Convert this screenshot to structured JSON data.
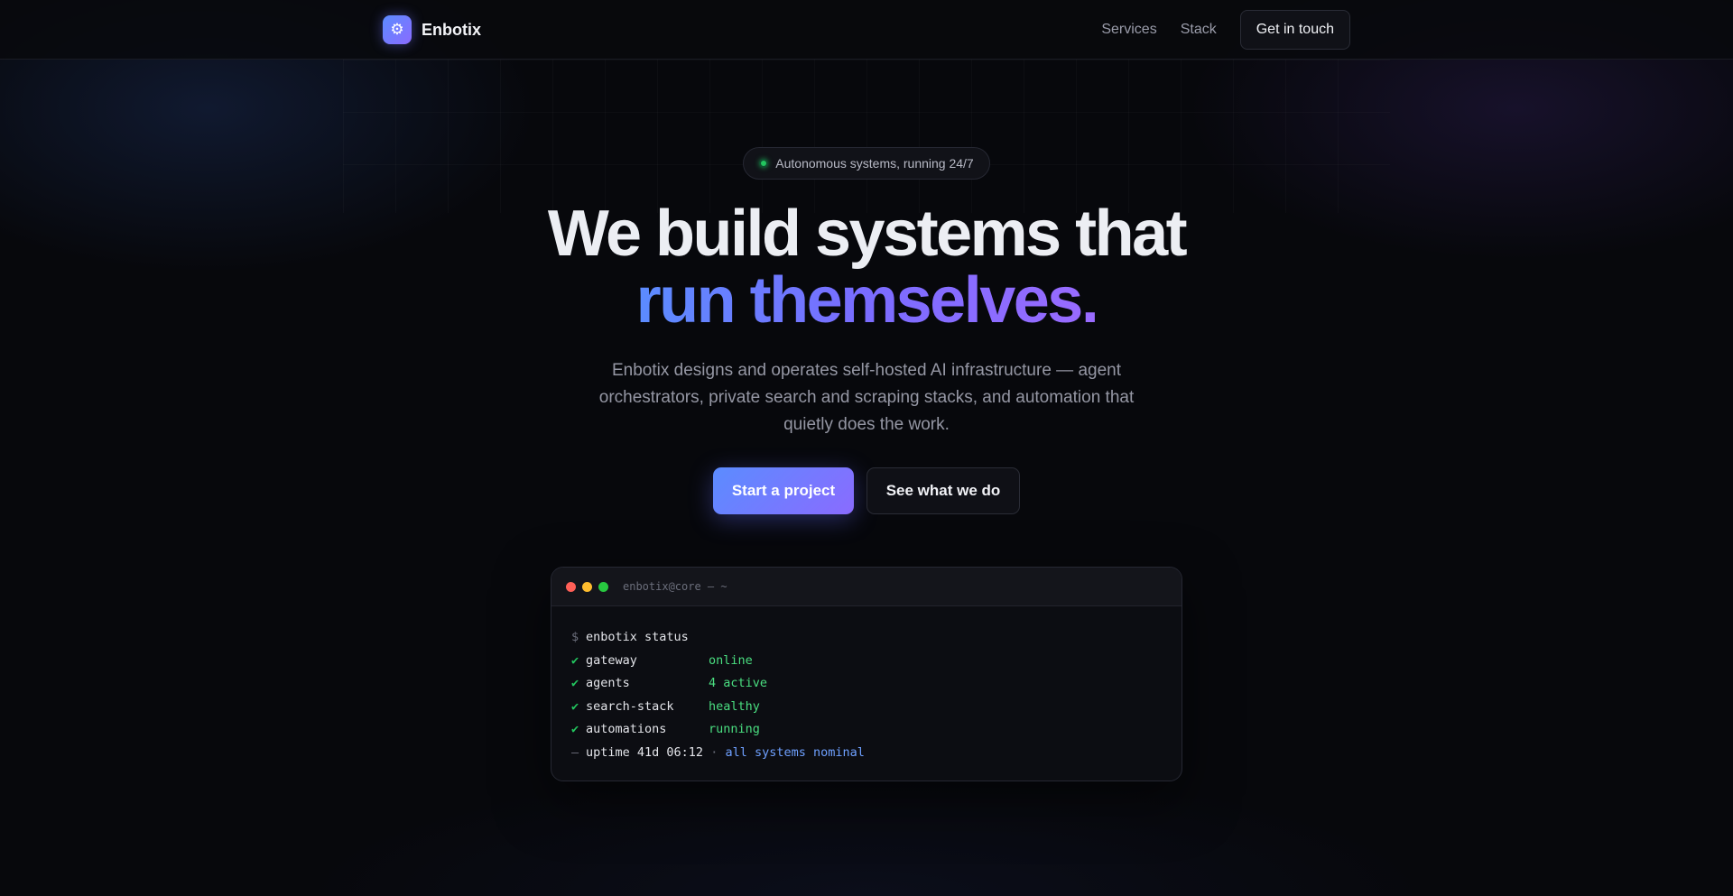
{
  "nav": {
    "brand_icon": "gear-icon",
    "brand_name": "Enbotix",
    "links": [
      "Services",
      "Stack"
    ],
    "cta": "Get in touch"
  },
  "hero": {
    "badge": "Autonomous systems, running 24/7",
    "headline_line1": "We build systems that",
    "headline_line2": "run themselves.",
    "subtitle": "Enbotix designs and operates self-hosted AI infrastructure — agent orchestrators, private search and scraping stacks, and automation that quietly does the work.",
    "primary_button": "Start a project",
    "secondary_button": "See what we do"
  },
  "terminal": {
    "title": "enbotix@core — ~",
    "prompt": "$",
    "command": "enbotix status",
    "rows": [
      {
        "mark": "✔",
        "key": "gateway",
        "value": "online"
      },
      {
        "mark": "✔",
        "key": "agents",
        "value": "4 active"
      },
      {
        "mark": "✔",
        "key": "search-stack",
        "value": "healthy"
      },
      {
        "mark": "✔",
        "key": "automations",
        "value": "running"
      }
    ],
    "footer_mark": "—",
    "uptime": "uptime 41d 06:12",
    "separator": "·",
    "status": "all systems nominal"
  },
  "colors": {
    "accent_start": "#5b8cff",
    "accent_end": "#8a6bff",
    "ok_green": "#22c55e",
    "background": "#07080c"
  }
}
